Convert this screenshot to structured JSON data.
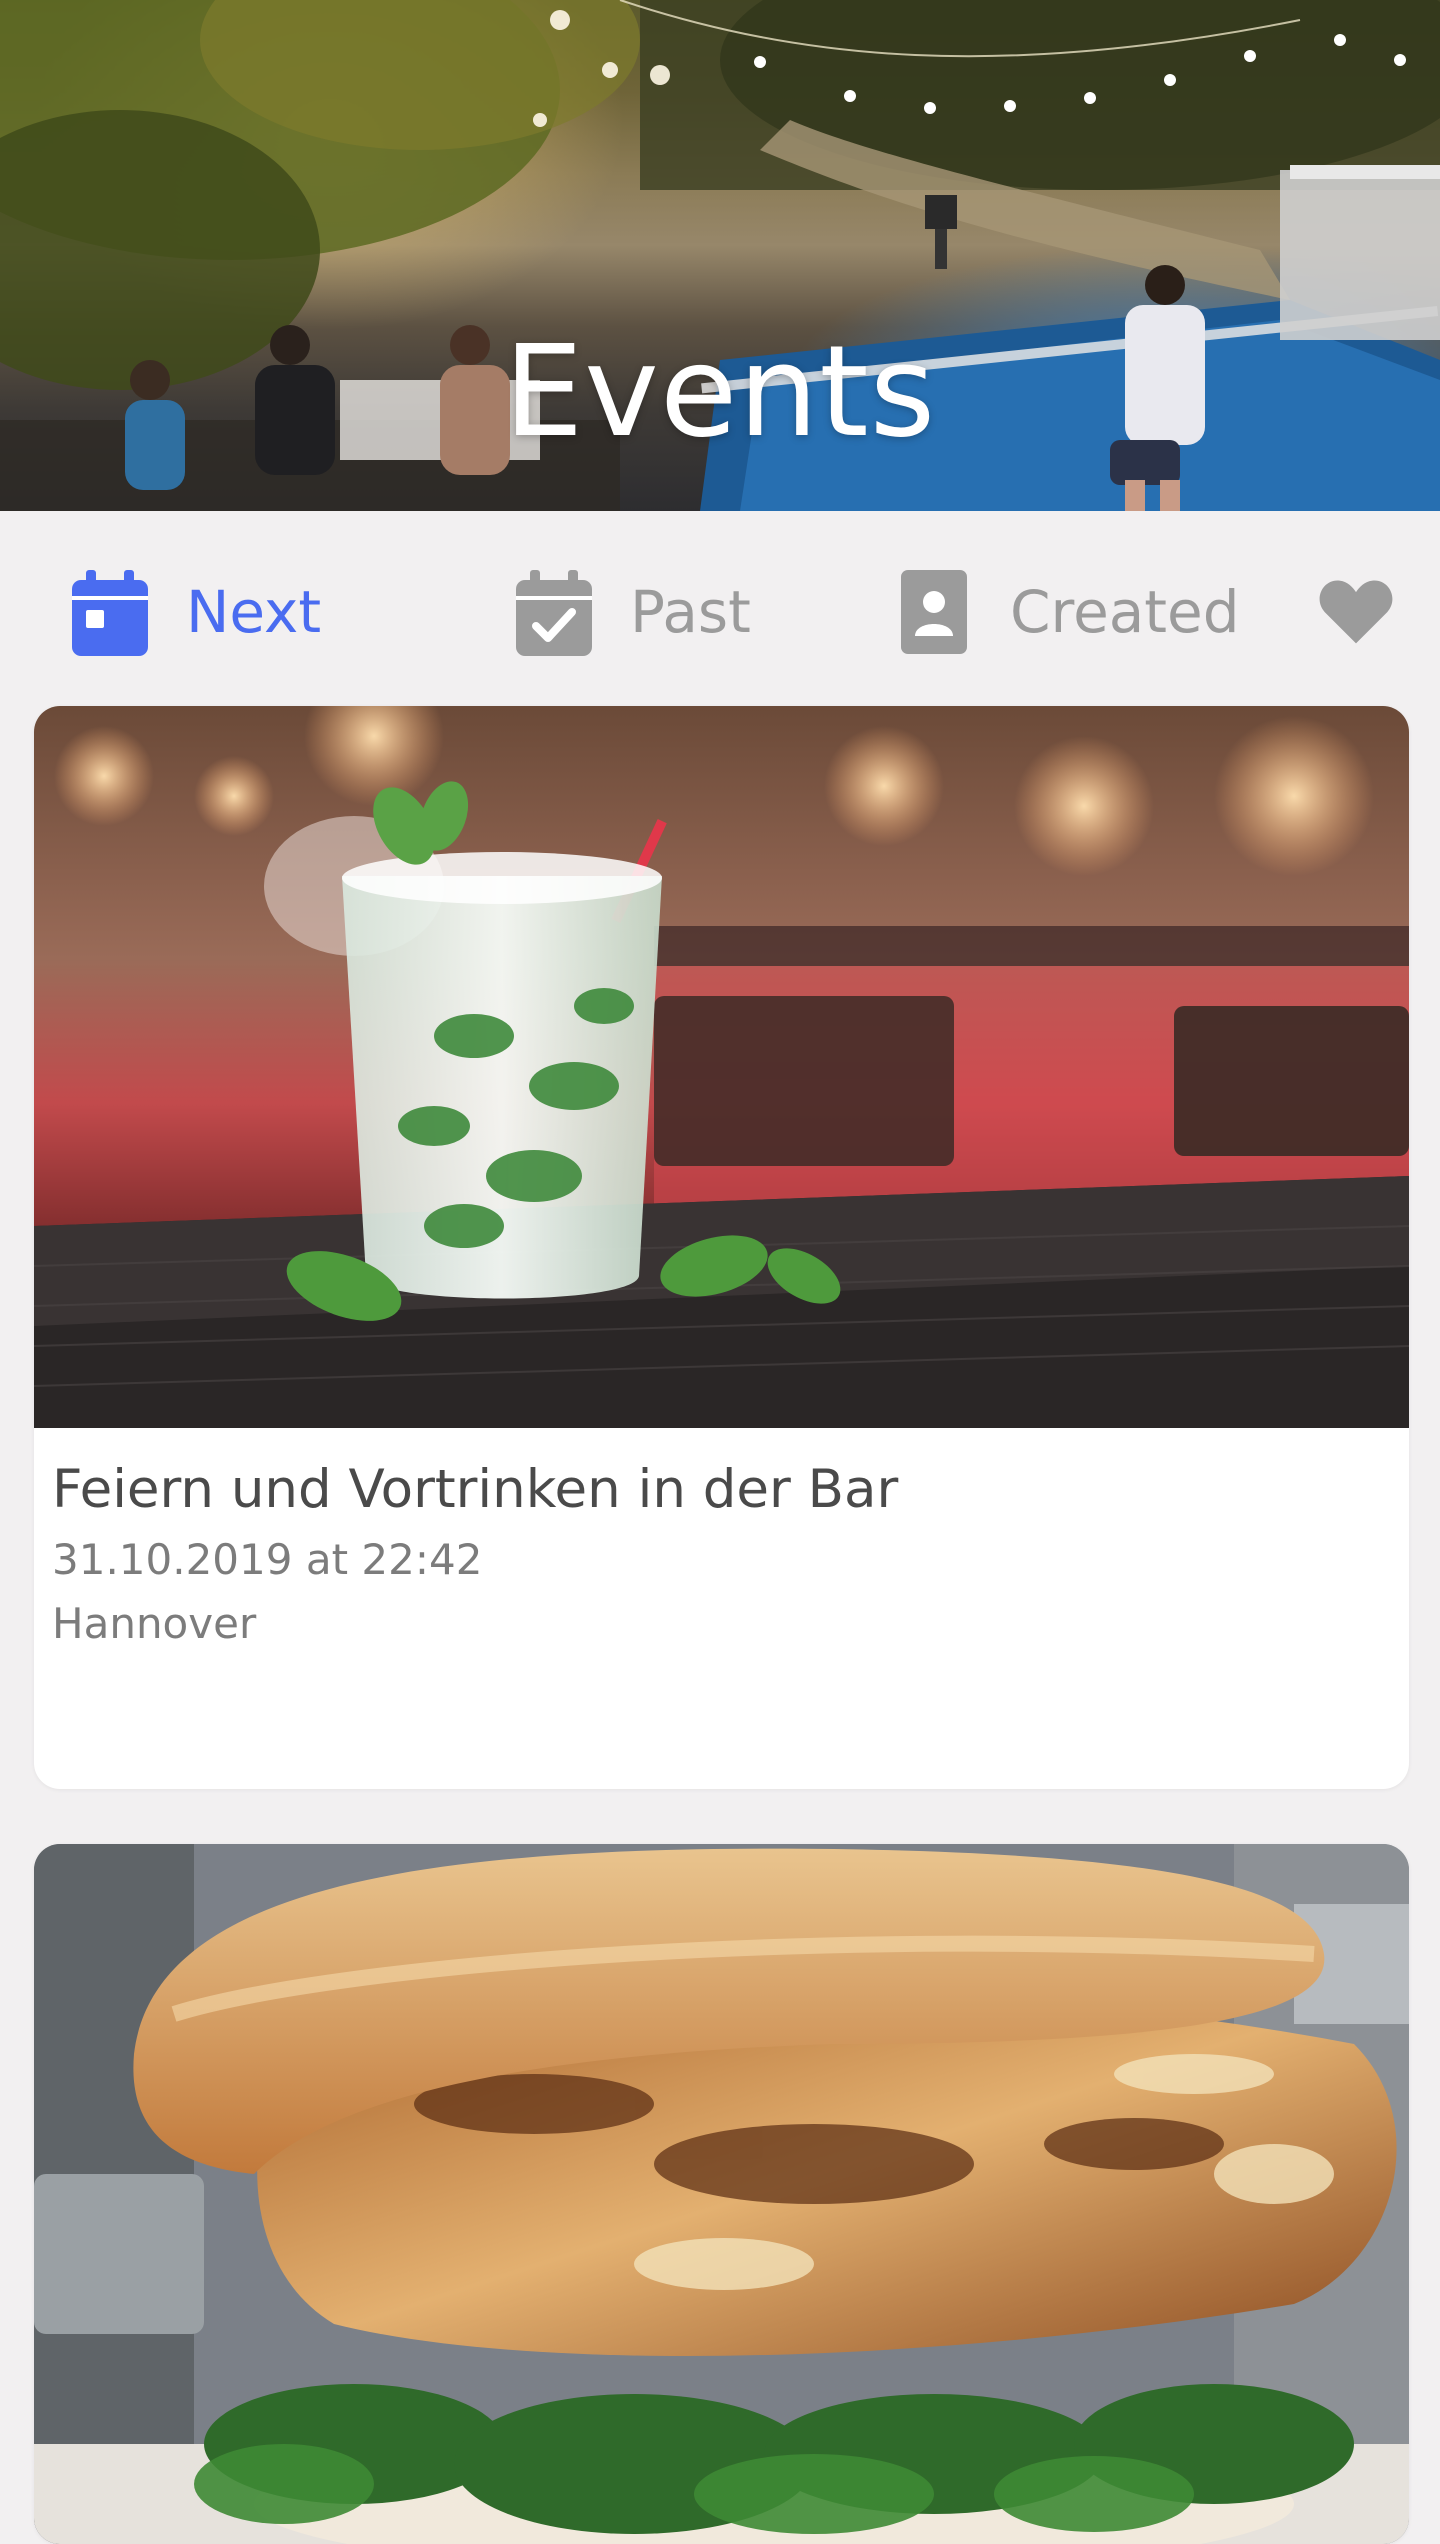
{
  "header": {
    "title": "Events"
  },
  "tabs": [
    {
      "id": "next",
      "label": "Next",
      "icon": "calendar-icon",
      "active": true
    },
    {
      "id": "past",
      "label": "Past",
      "icon": "calendar-check-icon",
      "active": false
    },
    {
      "id": "created",
      "label": "Created",
      "icon": "user-badge-icon",
      "active": false
    },
    {
      "id": "liked",
      "label": "",
      "icon": "heart-icon",
      "active": false
    }
  ],
  "events": [
    {
      "title": "Feiern und Vortrinken in der Bar",
      "date": "31.10.2019 at 22:42",
      "location": "Hannover",
      "image": "cocktail-bar-photo"
    },
    {
      "title": "",
      "date": "",
      "location": "",
      "image": "burger-photo"
    }
  ],
  "colors": {
    "accent": "#4a6cf0",
    "inactive": "#9b9b9b",
    "background": "#f2f0f1",
    "card": "#ffffff",
    "title_text": "#4a4a4a",
    "meta_text": "#7c7c7c"
  }
}
